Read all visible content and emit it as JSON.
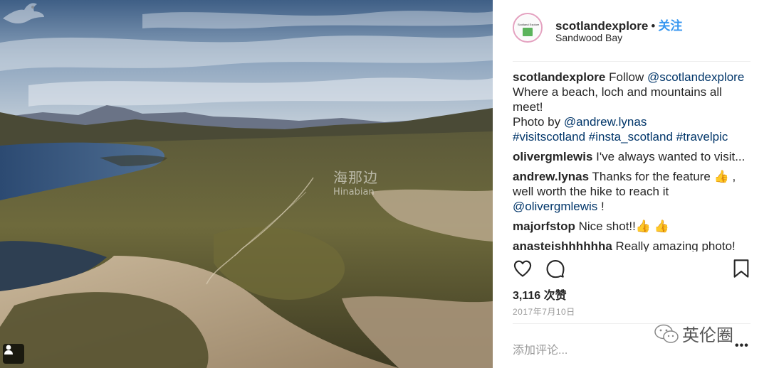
{
  "post": {
    "owner": "scotlandexplore",
    "separator": "•",
    "follow_label": "关注",
    "location": "Sandwood Bay",
    "avatar_text": "Scotland Explore"
  },
  "caption": {
    "user": "scotlandexplore",
    "text_1": "Follow ",
    "mention_1": "@scotlandexplore",
    "text_2": " Where a beach, loch and mountains all meet!",
    "text_3": "Photo by ",
    "mention_2": "@andrew.lynas",
    "hashtags": "#visitscotland #insta_scotland #travelpic"
  },
  "comments": [
    {
      "user": "olivergmlewis",
      "text": " I've always wanted to visit..."
    },
    {
      "user": "andrew.lynas",
      "text": " Thanks for the feature 👍 , well worth the hike to reach it ",
      "mention": "@olivergmlewis",
      "tail": " !"
    },
    {
      "user": "majorfstop",
      "text": " Nice shot!!👍 👍"
    },
    {
      "user": "anasteishhhhhha",
      "text": " Really amazing photo!"
    }
  ],
  "stats": {
    "likes": "3,116 次赞",
    "date": "2017年7月10日"
  },
  "add_comment_placeholder": "添加评论...",
  "more_label": "•••",
  "watermark": {
    "cn": "海那边",
    "en": "Hinabian"
  },
  "wechat_watermark": "英伦圈",
  "icons": {
    "like": "heart-icon",
    "comment": "comment-icon",
    "save": "bookmark-icon",
    "user_tag": "user-tag-icon"
  },
  "colors": {
    "link": "#003569",
    "follow": "#3897f0",
    "muted": "#999999"
  }
}
